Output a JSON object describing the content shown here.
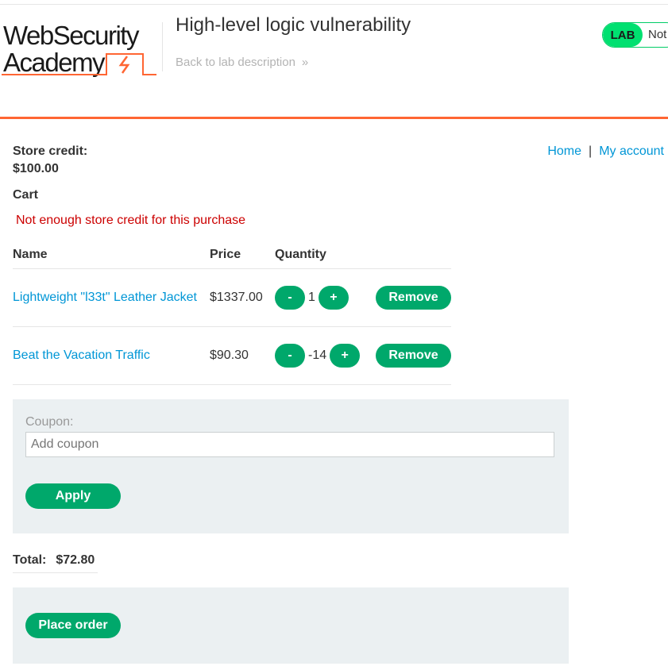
{
  "brand": {
    "line1": "WebSecurity",
    "line2": "Academy"
  },
  "lab": {
    "title": "High-level logic vulnerability",
    "back_label": "Back to lab description",
    "badge": "LAB",
    "status": "Not solved"
  },
  "account": {
    "credit_label": "Store credit:",
    "credit_value": "$100.00"
  },
  "nav": {
    "home": "Home",
    "separator": "|",
    "my_account": "My account"
  },
  "cart": {
    "heading": "Cart",
    "error": "Not enough store credit for this purchase",
    "columns": [
      "Name",
      "Price",
      "Quantity"
    ],
    "items": [
      {
        "name": "Lightweight \"l33t\" Leather Jacket",
        "price": "$1337.00",
        "quantity": "1",
        "decrement": "-",
        "increment": "+",
        "remove": "Remove"
      },
      {
        "name": "Beat the Vacation Traffic",
        "price": "$90.30",
        "quantity": "-14",
        "decrement": "-",
        "increment": "+",
        "remove": "Remove"
      }
    ]
  },
  "coupon": {
    "label": "Coupon:",
    "placeholder": "Add coupon",
    "apply": "Apply"
  },
  "total": {
    "label": "Total:",
    "value": "$72.80"
  },
  "order": {
    "button": "Place order"
  },
  "colors": {
    "accent": "#00a86b",
    "link": "#0096d6",
    "error": "#cc0000",
    "rule": "#ff6633",
    "status_green": "#00e070"
  }
}
